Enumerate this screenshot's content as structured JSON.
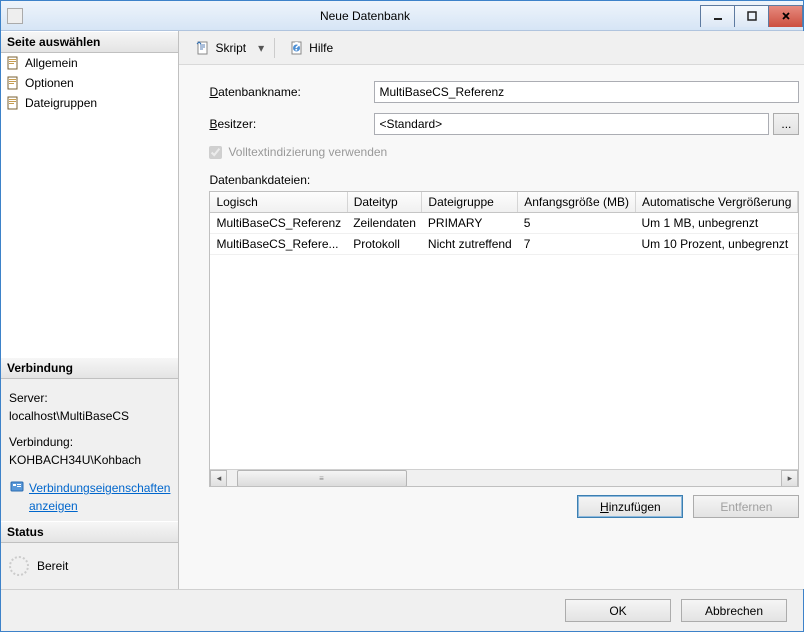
{
  "window": {
    "title": "Neue Datenbank"
  },
  "sidebar": {
    "select_page_header": "Seite auswählen",
    "nav_items": [
      {
        "label": "Allgemein"
      },
      {
        "label": "Optionen"
      },
      {
        "label": "Dateigruppen"
      }
    ],
    "connection_header": "Verbindung",
    "server_label": "Server:",
    "server_value": "localhost\\MultiBaseCS",
    "connection_label": "Verbindung:",
    "connection_value": "KOHBACH34U\\Kohbach",
    "connection_link": "Verbindungseigenschaften anzeigen",
    "status_header": "Status",
    "status_value": "Bereit"
  },
  "toolbar": {
    "script_label": "Skript",
    "help_label": "Hilfe"
  },
  "form": {
    "dbname_label_pre": "D",
    "dbname_label_post": "atenbankname:",
    "dbname_value": "MultiBaseCS_Referenz",
    "owner_label_pre": "B",
    "owner_label_post": "esitzer:",
    "owner_value": "<Standard>",
    "browse_label": "...",
    "fulltext_label": "Volltextindizierung verwenden",
    "files_label": "Datenbankdateien:"
  },
  "table": {
    "headers": {
      "logical": "Logisch",
      "filetype": "Dateityp",
      "filegroup": "Dateigruppe",
      "initsize": "Anfangsgröße (MB)",
      "autogrow": "Automatische Vergrößerung"
    },
    "rows": [
      {
        "logical": "MultiBaseCS_Referenz",
        "filetype": "Zeilendaten",
        "filegroup": "PRIMARY",
        "initsize": "5",
        "autogrow": "Um 1 MB, unbegrenzt"
      },
      {
        "logical": "MultiBaseCS_Refere...",
        "filetype": "Protokoll",
        "filegroup": "Nicht zutreffend",
        "initsize": "7",
        "autogrow": "Um 10 Prozent, unbegrenzt"
      }
    ]
  },
  "buttons": {
    "add": "Hinzufügen",
    "remove": "Entfernen",
    "ok": "OK",
    "cancel": "Abbrechen"
  }
}
